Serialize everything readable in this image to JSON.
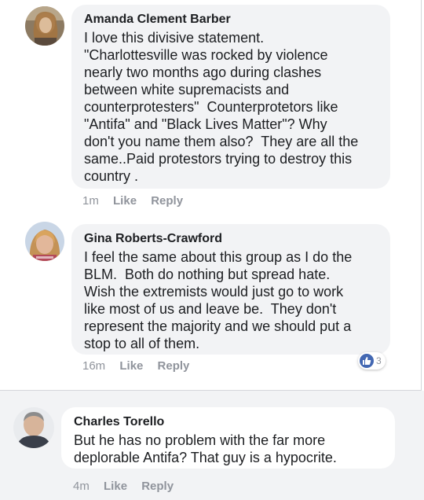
{
  "comments": [
    {
      "author": "Amanda Clement Barber",
      "text": "I love this divisive statement.\n\"Charlottesville was rocked by violence\nnearly two months ago during clashes\nbetween white supremacists and\ncounterprotesters\"  Counterprotetors like\n\"Antifa\" and \"Black Lives Matter\"? Why\ndon't you name them also?  They are all the\nsame..Paid protestors trying to destroy this\ncountry .",
      "time": "1m",
      "like_label": "Like",
      "reply_label": "Reply"
    },
    {
      "author": "Gina Roberts-Crawford",
      "text": "I feel the same about this group as I do the\nBLM.  Both do nothing but spread hate.\nWish the extremists would just go to work\nlike most of us and leave be.  They don't\nrepresent the majority and we should put a\nstop to all of them.",
      "time": "16m",
      "like_label": "Like",
      "reply_label": "Reply",
      "reaction": {
        "icon": "thumbs-up-icon",
        "count": "3",
        "color": "#4267b2"
      }
    },
    {
      "author": "Charles Torello",
      "text": "But he has no problem with the far more\ndeplorable Antifa? That guy is a hypocrite.",
      "time": "4m",
      "like_label": "Like",
      "reply_label": "Reply"
    }
  ],
  "colors": {
    "bubble": "#f2f3f5",
    "text": "#1c1e21",
    "meta": "#90949c",
    "accent": "#4267b2"
  }
}
